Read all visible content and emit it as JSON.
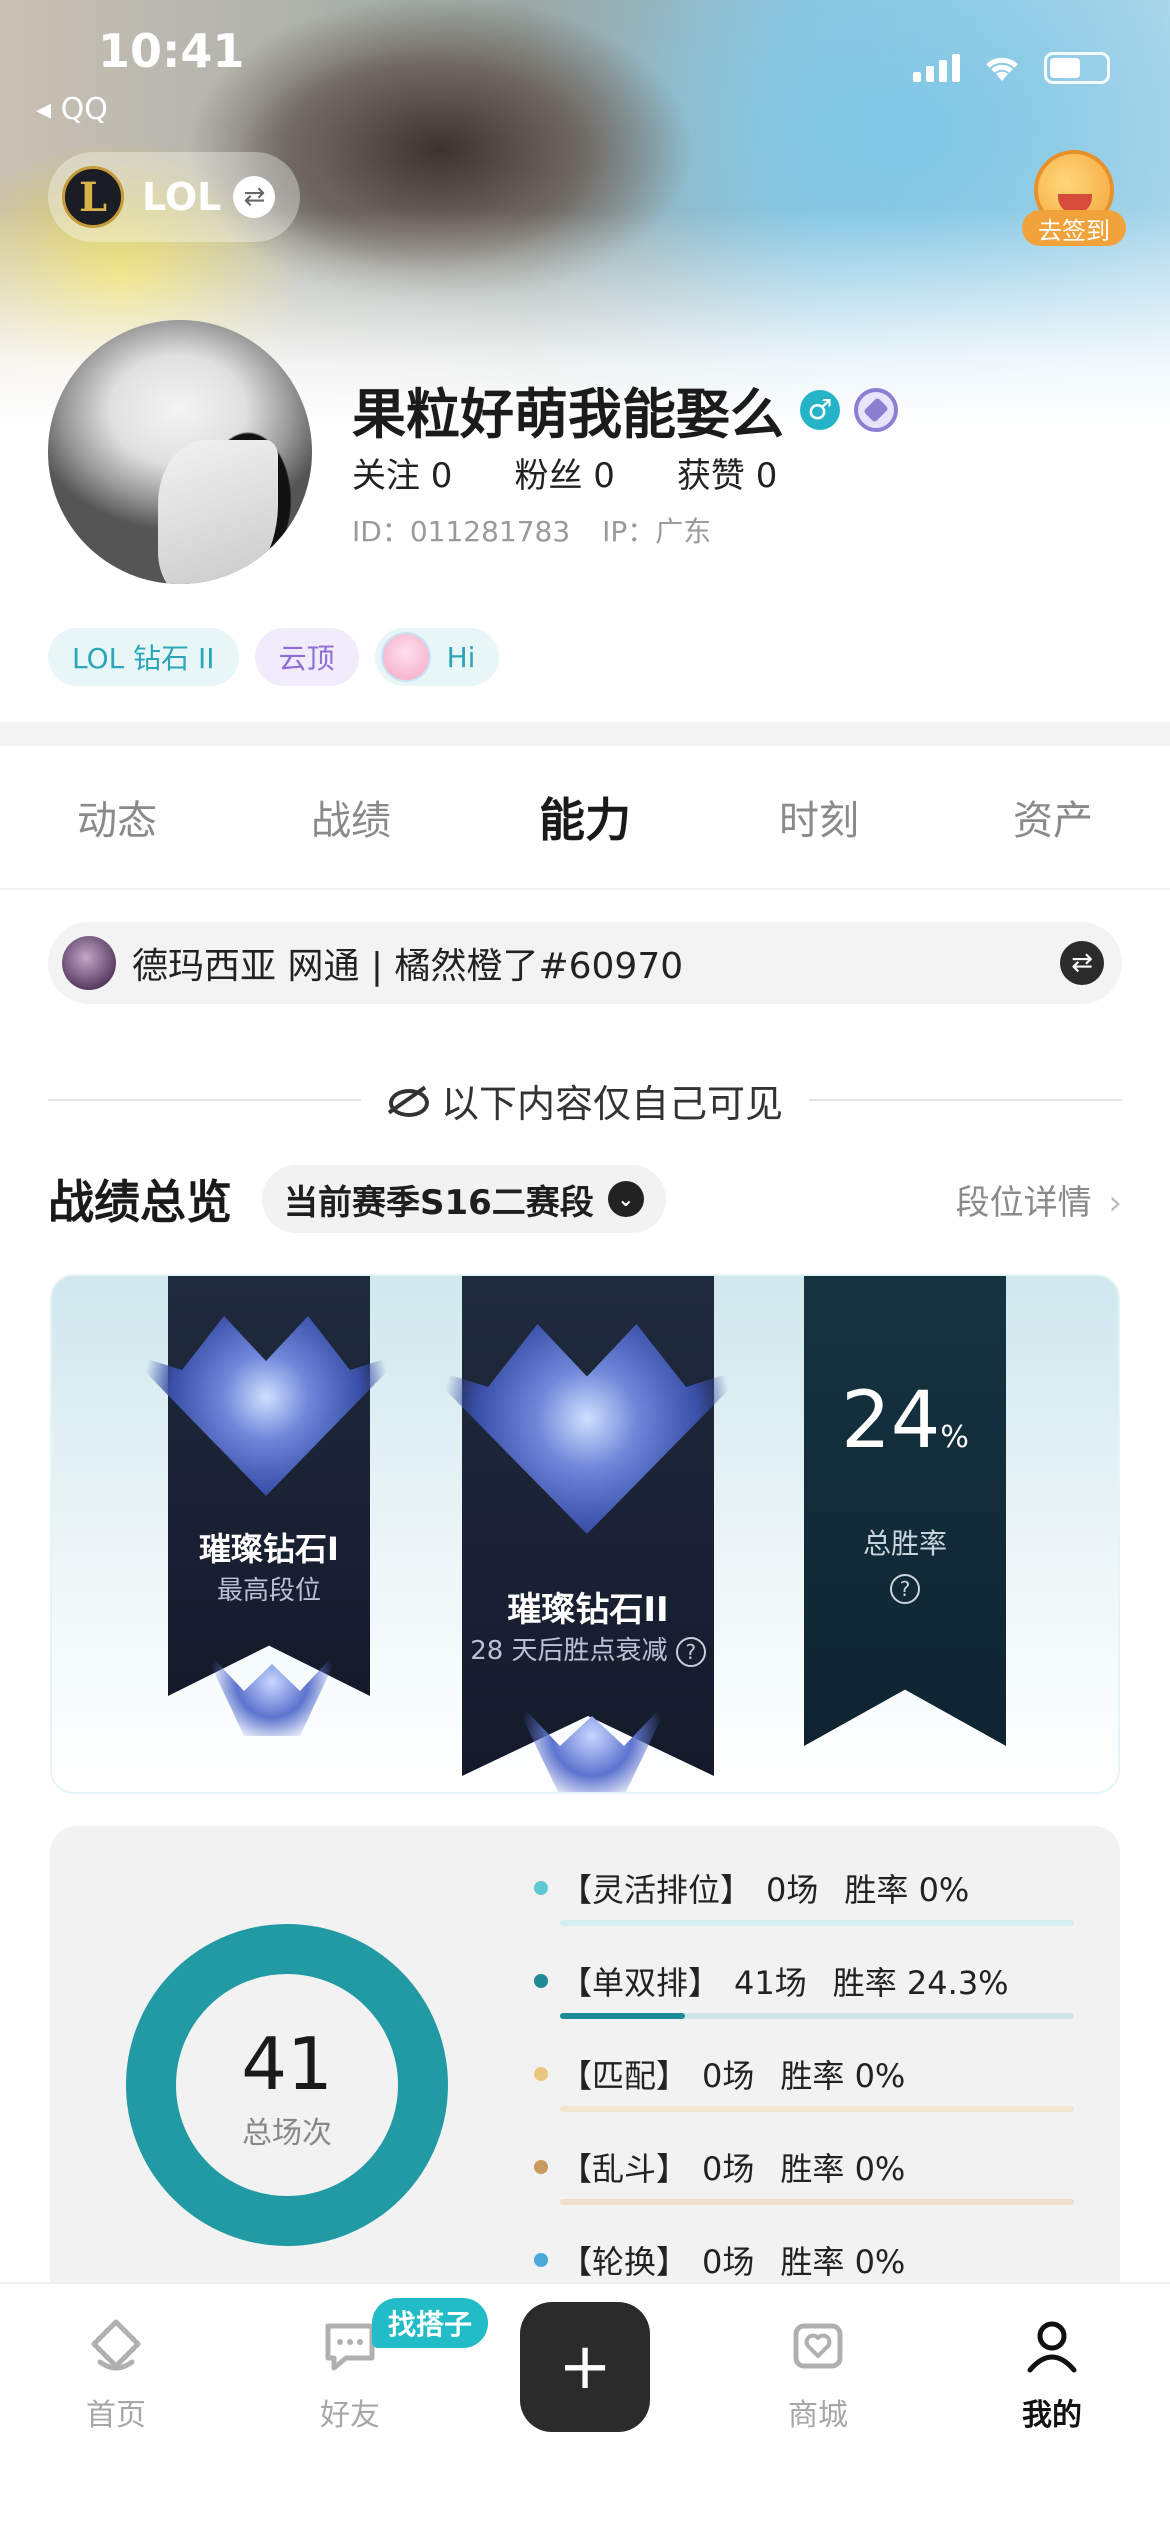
{
  "status_bar": {
    "time": "10:41",
    "back_app": "◂ QQ"
  },
  "game_switch": {
    "logo": "L",
    "label": "LOL"
  },
  "checkin": {
    "label": "去签到"
  },
  "profile": {
    "username": "果粒好萌我能娶么",
    "gender_icon": "♂",
    "follow": "关注 0",
    "fans": "粉丝 0",
    "likes": "获赞 0",
    "id": "ID：011281783",
    "ip": "IP：广东"
  },
  "tags": [
    {
      "label": "LOL 钻石 II"
    },
    {
      "label": "云顶"
    },
    {
      "label": "Hi"
    }
  ],
  "tabs": [
    {
      "label": "动态"
    },
    {
      "label": "战绩"
    },
    {
      "label": "能力"
    },
    {
      "label": "时刻"
    },
    {
      "label": "资产"
    }
  ],
  "active_tab": "能力",
  "account": {
    "text": "德玛西亚 网通 | 橘然橙了#60970"
  },
  "visibility_note": "以下内容仅自己可见",
  "overview": {
    "title": "战绩总览",
    "season": "当前赛季S16二赛段",
    "detail_link": "段位详情",
    "highest_rank": "璀璨钻石I",
    "highest_rank_sub": "最高段位",
    "current_rank": "璀璨钻石II",
    "current_rank_sub": "28 天后胜点衰减",
    "win_rate_value": "24",
    "win_rate_unit": "%",
    "win_rate_label": "总胜率",
    "question_mark": "?"
  },
  "stats": {
    "total": "41",
    "total_label": "总场次",
    "modes": [
      {
        "name": "【灵活排位】",
        "games": "0场",
        "rate": "胜率 0%",
        "fill": 0,
        "color": "#5fc9d3",
        "track": "#d6eef0"
      },
      {
        "name": "【单双排】",
        "games": "41场",
        "rate": "胜率 24.3%",
        "fill": 0.243,
        "color": "#1e8c96",
        "track": "#cfe6e8"
      },
      {
        "name": "【匹配】",
        "games": "0场",
        "rate": "胜率 0%",
        "fill": 0,
        "color": "#e8c77c",
        "track": "#f1e6cf"
      },
      {
        "name": "【乱斗】",
        "games": "0场",
        "rate": "胜率 0%",
        "fill": 0,
        "color": "#c89a5e",
        "track": "#eee0cc"
      },
      {
        "name": "【轮换】",
        "games": "0场",
        "rate": "胜率 0%",
        "fill": 0,
        "color": "#4aa9d8",
        "track": "#d6eaf4"
      }
    ]
  },
  "bottom_nav": {
    "home": "首页",
    "friends": "好友",
    "partner_badge": "找搭子",
    "add": "+",
    "shop": "商城",
    "me": "我的"
  }
}
